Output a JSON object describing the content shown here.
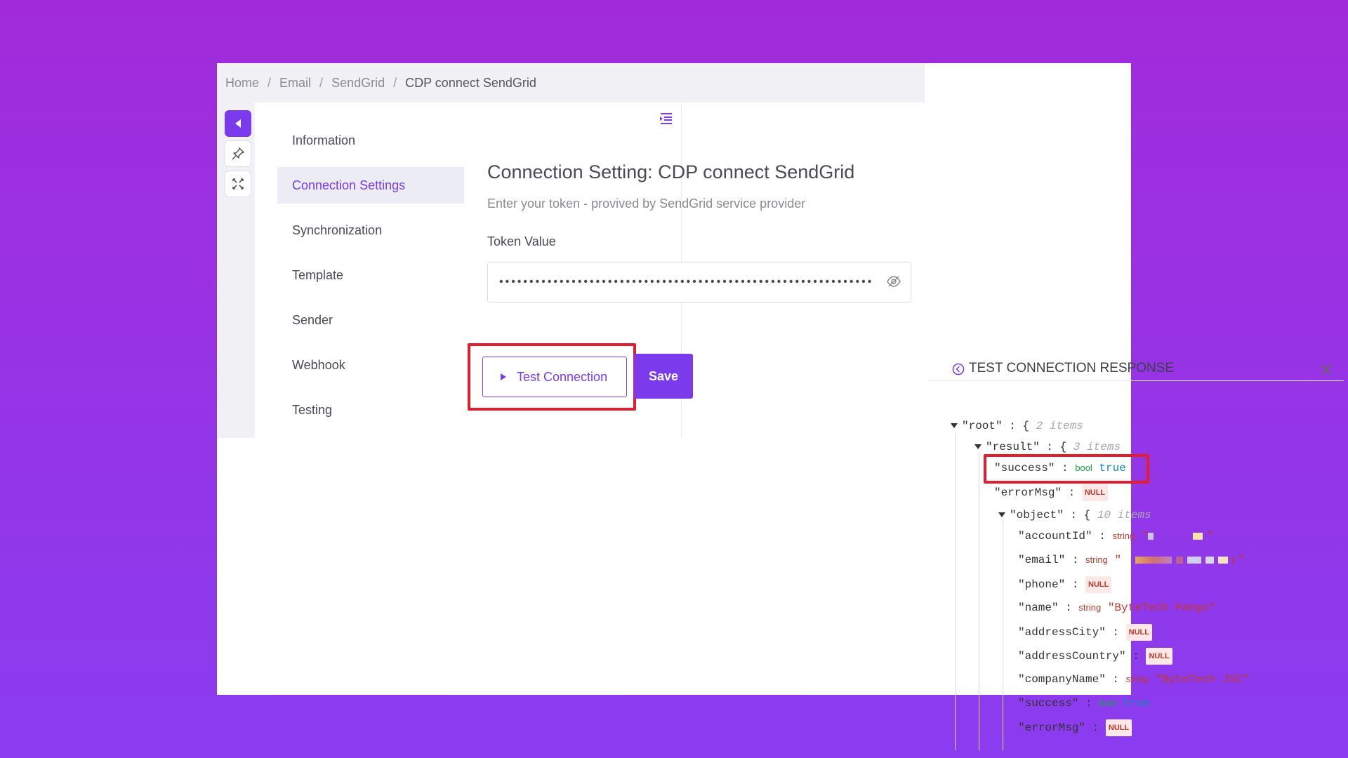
{
  "breadcrumb": {
    "items": [
      "Home",
      "Email",
      "SendGrid"
    ],
    "current": "CDP connect SendGrid",
    "separator": "/"
  },
  "toolbar": {
    "collapse_icon": "chevron-left-icon",
    "pin_icon": "pin-icon",
    "fullscreen_icon": "fullscreen-icon"
  },
  "nav": {
    "items": [
      {
        "label": "Information"
      },
      {
        "label": "Connection Settings"
      },
      {
        "label": "Synchronization"
      },
      {
        "label": "Template"
      },
      {
        "label": "Sender"
      },
      {
        "label": "Webhook"
      },
      {
        "label": "Testing"
      }
    ],
    "active": "Connection Settings"
  },
  "content": {
    "title": "Connection Setting: CDP connect SendGrid",
    "subtitle": "Enter your token - provived by SendGrid service provider",
    "token_label": "Token Value",
    "token_value": "•••••••••••••••••••••••••••••••••••••••••••••••••••••••••••••••••••••••••••••••••••••••"
  },
  "buttons": {
    "test": "Test Connection",
    "save": "Save"
  },
  "response": {
    "title": "TEST CONNECTION RESPONSE",
    "json": {
      "root_key": "\"root\"",
      "root_meta": "2 items",
      "result_key": "\"result\"",
      "result_meta": "3 items",
      "success_key": "\"success\"",
      "errorMsg_key": "\"errorMsg\"",
      "object_key": "\"object\"",
      "object_meta": "10 items",
      "accountId_key": "\"accountId\"",
      "email_key": "\"email\"",
      "phone_key": "\"phone\"",
      "name_key": "\"name\"",
      "name_value": "\"ByteTech Pango\"",
      "addressCity_key": "\"addressCity\"",
      "addressCountry_key": "\"addressCountry\"",
      "companyName_key": "\"companyName\"",
      "companyName_value": "\"ByteTech JSC\"",
      "success2_key": "\"success\"",
      "errorMsg2_key": "\"errorMsg\"",
      "type_bool": "bool",
      "type_string": "string",
      "null_label": "NULL",
      "true_value": "true",
      "colon": " : ",
      "open_brace": "{",
      "quote": "\""
    }
  },
  "colors": {
    "accent": "#7c3aed",
    "highlight": "#e11d2e",
    "background_top": "#a12bdb",
    "background_bottom": "#8b3cf0"
  }
}
